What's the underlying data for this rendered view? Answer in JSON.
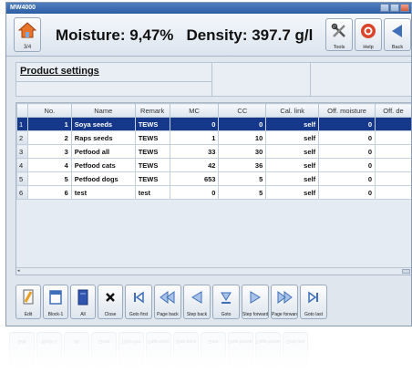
{
  "window": {
    "title": "MW4000"
  },
  "header": {
    "home_number": "3/4",
    "moisture": "Moisture: 9,47%",
    "density": "Density: 397.7 g/l",
    "buttons": [
      {
        "label": "Tools",
        "icon": "tools-icon"
      },
      {
        "label": "Help",
        "icon": "help-icon"
      },
      {
        "label": "Back",
        "icon": "back-arrow-icon"
      }
    ]
  },
  "product_settings": {
    "title": "Product settings"
  },
  "grid": {
    "columns": [
      "",
      "No.",
      "Name",
      "Remark",
      "MC",
      "CC",
      "Cal. link",
      "Off. moisture",
      "Off. de"
    ],
    "rows": [
      {
        "row": "1",
        "no": "1",
        "name": "Soya seeds",
        "remark": "TEWS",
        "mc": "0",
        "cc": "0",
        "cal": "self",
        "offm": "0",
        "selected": true
      },
      {
        "row": "2",
        "no": "2",
        "name": "Raps seeds",
        "remark": "TEWS",
        "mc": "1",
        "cc": "10",
        "cal": "self",
        "offm": "0",
        "selected": false
      },
      {
        "row": "3",
        "no": "3",
        "name": "Petfood all",
        "remark": "TEWS",
        "mc": "33",
        "cc": "30",
        "cal": "self",
        "offm": "0",
        "selected": false
      },
      {
        "row": "4",
        "no": "4",
        "name": "Petfood cats",
        "remark": "TEWS",
        "mc": "42",
        "cc": "36",
        "cal": "self",
        "offm": "0",
        "selected": false
      },
      {
        "row": "5",
        "no": "5",
        "name": "Petfood dogs",
        "remark": "TEWS",
        "mc": "653",
        "cc": "5",
        "cal": "self",
        "offm": "0",
        "selected": false
      },
      {
        "row": "6",
        "no": "6",
        "name": "test",
        "remark": "test",
        "mc": "0",
        "cc": "5",
        "cal": "self",
        "offm": "0",
        "selected": false
      }
    ]
  },
  "toolbar": {
    "buttons": [
      {
        "label": "Edit",
        "icon": "pencil-icon"
      },
      {
        "label": "Block-1",
        "icon": "window-icon"
      },
      {
        "label": "All",
        "icon": "book-icon"
      },
      {
        "label": "Close",
        "icon": "x-icon"
      },
      {
        "label": "Goto first",
        "icon": "goto-first-icon"
      },
      {
        "label": "Page back",
        "icon": "page-back-icon"
      },
      {
        "label": "Step back",
        "icon": "step-back-icon"
      },
      {
        "label": "Goto",
        "icon": "goto-icon"
      },
      {
        "label": "Step forward",
        "icon": "step-forward-icon"
      },
      {
        "label": "Page forward",
        "icon": "page-forward-icon"
      },
      {
        "label": "Goto last",
        "icon": "goto-last-icon"
      }
    ]
  },
  "colors": {
    "selection": "#16388a",
    "title_bar": "#2e5ea3",
    "accent_orange": "#e8742a"
  }
}
